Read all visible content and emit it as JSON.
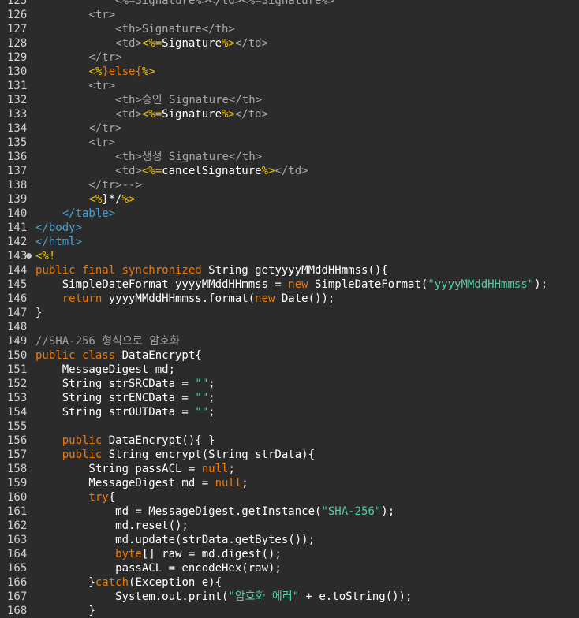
{
  "colors": {
    "background": "#2b2b2b",
    "line_number": "#d0d0d0",
    "html_tag": "#4a9fd0",
    "dim_text": "#a8a8a8",
    "jsp_delimiter": "#f0c000",
    "keyword": "#f07800",
    "string": "#50d0a0",
    "comment": "#a0a0a0",
    "identifier": "#ffffff"
  },
  "lines": [
    {
      "num": "125",
      "fold": false,
      "tokens": [
        {
          "t": "attr",
          "v": "            <%=Signature%></td><%=Signature%>"
        }
      ]
    },
    {
      "num": "126",
      "fold": false,
      "tokens": [
        {
          "t": "attr",
          "v": "        <tr>"
        }
      ]
    },
    {
      "num": "127",
      "fold": false,
      "tokens": [
        {
          "t": "attr",
          "v": "            <th>Signature</th>"
        }
      ]
    },
    {
      "num": "128",
      "fold": false,
      "tokens": [
        {
          "t": "attr",
          "v": "            <td>"
        },
        {
          "t": "delim",
          "v": "<%="
        },
        {
          "t": "plain",
          "v": "Signature"
        },
        {
          "t": "delim",
          "v": "%>"
        },
        {
          "t": "attr",
          "v": "</td>"
        }
      ]
    },
    {
      "num": "129",
      "fold": false,
      "tokens": [
        {
          "t": "attr",
          "v": "        </tr>"
        }
      ]
    },
    {
      "num": "130",
      "fold": false,
      "tokens": [
        {
          "t": "attr",
          "v": "        "
        },
        {
          "t": "delim",
          "v": "<%"
        },
        {
          "t": "kw",
          "v": "}else{"
        },
        {
          "t": "delim",
          "v": "%>"
        }
      ]
    },
    {
      "num": "131",
      "fold": false,
      "tokens": [
        {
          "t": "attr",
          "v": "        <tr>"
        }
      ]
    },
    {
      "num": "132",
      "fold": false,
      "tokens": [
        {
          "t": "attr",
          "v": "            <th>승인 Signature</th>"
        }
      ]
    },
    {
      "num": "133",
      "fold": false,
      "tokens": [
        {
          "t": "attr",
          "v": "            <td>"
        },
        {
          "t": "delim",
          "v": "<%="
        },
        {
          "t": "plain",
          "v": "Signature"
        },
        {
          "t": "delim",
          "v": "%>"
        },
        {
          "t": "attr",
          "v": "</td>"
        }
      ]
    },
    {
      "num": "134",
      "fold": false,
      "tokens": [
        {
          "t": "attr",
          "v": "        </tr>"
        }
      ]
    },
    {
      "num": "135",
      "fold": false,
      "tokens": [
        {
          "t": "attr",
          "v": "        <tr>"
        }
      ]
    },
    {
      "num": "136",
      "fold": false,
      "tokens": [
        {
          "t": "attr",
          "v": "            <th>생성 Signature</th>"
        }
      ]
    },
    {
      "num": "137",
      "fold": false,
      "tokens": [
        {
          "t": "attr",
          "v": "            <td>"
        },
        {
          "t": "delim",
          "v": "<%="
        },
        {
          "t": "plain",
          "v": "cancelSignature"
        },
        {
          "t": "delim",
          "v": "%>"
        },
        {
          "t": "attr",
          "v": "</td>"
        }
      ]
    },
    {
      "num": "138",
      "fold": false,
      "tokens": [
        {
          "t": "attr",
          "v": "        </tr>-->"
        }
      ]
    },
    {
      "num": "139",
      "fold": false,
      "tokens": [
        {
          "t": "attr",
          "v": "        "
        },
        {
          "t": "delim",
          "v": "<%"
        },
        {
          "t": "plain",
          "v": "}*/"
        },
        {
          "t": "delim",
          "v": "%>"
        }
      ]
    },
    {
      "num": "140",
      "fold": false,
      "tokens": [
        {
          "t": "tag",
          "v": "    </table>"
        }
      ]
    },
    {
      "num": "141",
      "fold": false,
      "tokens": [
        {
          "t": "tag",
          "v": "</body>"
        }
      ]
    },
    {
      "num": "142",
      "fold": false,
      "tokens": [
        {
          "t": "tag",
          "v": "</html>"
        }
      ]
    },
    {
      "num": "143",
      "fold": true,
      "tokens": [
        {
          "t": "delim",
          "v": "<%!"
        }
      ]
    },
    {
      "num": "144",
      "fold": false,
      "tokens": [
        {
          "t": "kw",
          "v": "public final synchronized "
        },
        {
          "t": "plain",
          "v": "String getyyyyMMddHHmmss(){"
        }
      ]
    },
    {
      "num": "145",
      "fold": false,
      "tokens": [
        {
          "t": "plain",
          "v": "    SimpleDateFormat yyyyMMddHHmmss = "
        },
        {
          "t": "kw",
          "v": "new "
        },
        {
          "t": "plain",
          "v": "SimpleDateFormat("
        },
        {
          "t": "str",
          "v": "\"yyyyMMddHHmmss\""
        },
        {
          "t": "plain",
          "v": ");"
        }
      ]
    },
    {
      "num": "146",
      "fold": false,
      "tokens": [
        {
          "t": "kw",
          "v": "    return "
        },
        {
          "t": "plain",
          "v": "yyyyMMddHHmmss.format("
        },
        {
          "t": "kw",
          "v": "new "
        },
        {
          "t": "plain",
          "v": "Date());"
        }
      ]
    },
    {
      "num": "147",
      "fold": false,
      "tokens": [
        {
          "t": "plain",
          "v": "}"
        }
      ]
    },
    {
      "num": "148",
      "fold": false,
      "tokens": []
    },
    {
      "num": "149",
      "fold": false,
      "tokens": [
        {
          "t": "comment",
          "v": "//SHA-256 형식으로 암호화"
        }
      ]
    },
    {
      "num": "150",
      "fold": false,
      "tokens": [
        {
          "t": "kw",
          "v": "public class "
        },
        {
          "t": "plain",
          "v": "DataEncrypt{"
        }
      ]
    },
    {
      "num": "151",
      "fold": false,
      "tokens": [
        {
          "t": "plain",
          "v": "    MessageDigest md;"
        }
      ]
    },
    {
      "num": "152",
      "fold": false,
      "tokens": [
        {
          "t": "plain",
          "v": "    String strSRCData = "
        },
        {
          "t": "str",
          "v": "\"\""
        },
        {
          "t": "plain",
          "v": ";"
        }
      ]
    },
    {
      "num": "153",
      "fold": false,
      "tokens": [
        {
          "t": "plain",
          "v": "    String strENCData = "
        },
        {
          "t": "str",
          "v": "\"\""
        },
        {
          "t": "plain",
          "v": ";"
        }
      ]
    },
    {
      "num": "154",
      "fold": false,
      "tokens": [
        {
          "t": "plain",
          "v": "    String strOUTData = "
        },
        {
          "t": "str",
          "v": "\"\""
        },
        {
          "t": "plain",
          "v": ";"
        }
      ]
    },
    {
      "num": "155",
      "fold": false,
      "tokens": []
    },
    {
      "num": "156",
      "fold": false,
      "tokens": [
        {
          "t": "kw",
          "v": "    public "
        },
        {
          "t": "plain",
          "v": "DataEncrypt(){ }"
        }
      ]
    },
    {
      "num": "157",
      "fold": false,
      "tokens": [
        {
          "t": "kw",
          "v": "    public "
        },
        {
          "t": "plain",
          "v": "String encrypt(String strData){"
        }
      ]
    },
    {
      "num": "158",
      "fold": false,
      "tokens": [
        {
          "t": "plain",
          "v": "        String passACL = "
        },
        {
          "t": "kw",
          "v": "null"
        },
        {
          "t": "plain",
          "v": ";"
        }
      ]
    },
    {
      "num": "159",
      "fold": false,
      "tokens": [
        {
          "t": "plain",
          "v": "        MessageDigest md = "
        },
        {
          "t": "kw",
          "v": "null"
        },
        {
          "t": "plain",
          "v": ";"
        }
      ]
    },
    {
      "num": "160",
      "fold": false,
      "tokens": [
        {
          "t": "kw",
          "v": "        try"
        },
        {
          "t": "plain",
          "v": "{"
        }
      ]
    },
    {
      "num": "161",
      "fold": false,
      "tokens": [
        {
          "t": "plain",
          "v": "            md = MessageDigest.getInstance("
        },
        {
          "t": "str",
          "v": "\"SHA-256\""
        },
        {
          "t": "plain",
          "v": ");"
        }
      ]
    },
    {
      "num": "162",
      "fold": false,
      "tokens": [
        {
          "t": "plain",
          "v": "            md.reset();"
        }
      ]
    },
    {
      "num": "163",
      "fold": false,
      "tokens": [
        {
          "t": "plain",
          "v": "            md.update(strData.getBytes());"
        }
      ]
    },
    {
      "num": "164",
      "fold": false,
      "tokens": [
        {
          "t": "kw",
          "v": "            byte"
        },
        {
          "t": "plain",
          "v": "[] raw = md.digest();"
        }
      ]
    },
    {
      "num": "165",
      "fold": false,
      "tokens": [
        {
          "t": "plain",
          "v": "            passACL = encodeHex(raw);"
        }
      ]
    },
    {
      "num": "166",
      "fold": false,
      "tokens": [
        {
          "t": "plain",
          "v": "        }"
        },
        {
          "t": "kw",
          "v": "catch"
        },
        {
          "t": "plain",
          "v": "(Exception e){"
        }
      ]
    },
    {
      "num": "167",
      "fold": false,
      "tokens": [
        {
          "t": "plain",
          "v": "            System.out.print("
        },
        {
          "t": "str",
          "v": "\"암호화 에러\""
        },
        {
          "t": "plain",
          "v": " + e.toString());"
        }
      ]
    },
    {
      "num": "168",
      "fold": false,
      "tokens": [
        {
          "t": "plain",
          "v": "        }"
        }
      ]
    }
  ]
}
